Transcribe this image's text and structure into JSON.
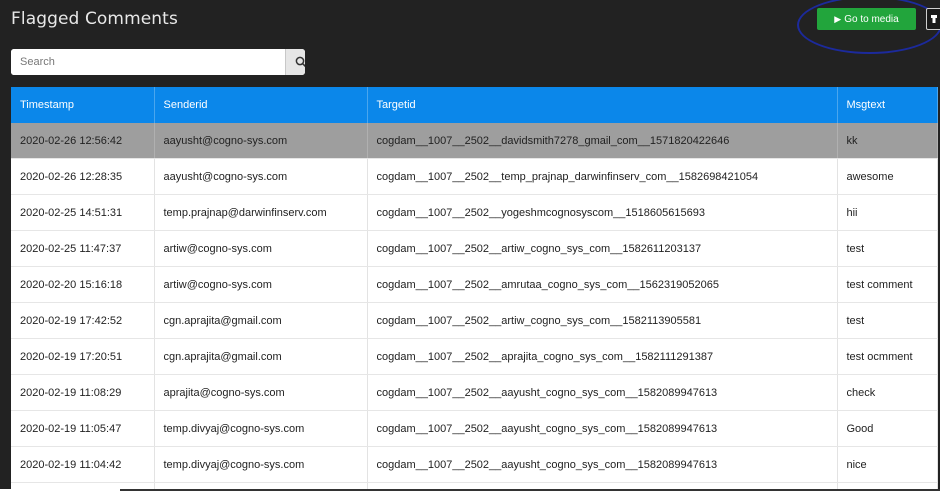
{
  "header": {
    "title": "Flagged Comments",
    "go_to_media_label": "Go to media",
    "play_icon": "▶"
  },
  "search": {
    "placeholder": "Search",
    "value": ""
  },
  "table": {
    "columns": [
      "Timestamp",
      "Senderid",
      "Targetid",
      "Msgtext"
    ],
    "rows": [
      {
        "timestamp": "2020-02-26 12:56:42",
        "senderid": "aayusht@cogno-sys.com",
        "targetid": "cogdam__1007__2502__davidsmith7278_gmail_com__1571820422646",
        "msgtext": "kk",
        "selected": true
      },
      {
        "timestamp": "2020-02-26 12:28:35",
        "senderid": "aayusht@cogno-sys.com",
        "targetid": "cogdam__1007__2502__temp_prajnap_darwinfinserv_com__1582698421054",
        "msgtext": "awesome"
      },
      {
        "timestamp": "2020-02-25 14:51:31",
        "senderid": "temp.prajnap@darwinfinserv.com",
        "targetid": "cogdam__1007__2502__yogeshmcognosyscom__1518605615693",
        "msgtext": "hii"
      },
      {
        "timestamp": "2020-02-25 11:47:37",
        "senderid": "artiw@cogno-sys.com",
        "targetid": "cogdam__1007__2502__artiw_cogno_sys_com__1582611203137",
        "msgtext": "test"
      },
      {
        "timestamp": "2020-02-20 15:16:18",
        "senderid": "artiw@cogno-sys.com",
        "targetid": "cogdam__1007__2502__amrutaa_cogno_sys_com__1562319052065",
        "msgtext": "test comment"
      },
      {
        "timestamp": "2020-02-19 17:42:52",
        "senderid": "cgn.aprajita@gmail.com",
        "targetid": "cogdam__1007__2502__artiw_cogno_sys_com__1582113905581",
        "msgtext": "test"
      },
      {
        "timestamp": "2020-02-19 17:20:51",
        "senderid": "cgn.aprajita@gmail.com",
        "targetid": "cogdam__1007__2502__aprajita_cogno_sys_com__1582111291387",
        "msgtext": "test ocmment"
      },
      {
        "timestamp": "2020-02-19 11:08:29",
        "senderid": "aprajita@cogno-sys.com",
        "targetid": "cogdam__1007__2502__aayusht_cogno_sys_com__1582089947613",
        "msgtext": "check"
      },
      {
        "timestamp": "2020-02-19 11:05:47",
        "senderid": "temp.divyaj@cogno-sys.com",
        "targetid": "cogdam__1007__2502__aayusht_cogno_sys_com__1582089947613",
        "msgtext": "Good"
      },
      {
        "timestamp": "2020-02-19 11:04:42",
        "senderid": "temp.divyaj@cogno-sys.com",
        "targetid": "cogdam__1007__2502__aayusht_cogno_sys_com__1582089947613",
        "msgtext": "nice"
      },
      {
        "timestamp": "",
        "senderid": "",
        "targetid": "",
        "msgtext": ""
      }
    ]
  },
  "colors": {
    "background": "#222222",
    "header_blue": "#0b87ea",
    "go_button_green": "#22a53c",
    "selected_row": "#9e9e9e",
    "annotation_circle": "#1c2a9c"
  },
  "icons": {
    "search": "search-icon",
    "play": "play-icon",
    "extra": "tool-icon"
  }
}
